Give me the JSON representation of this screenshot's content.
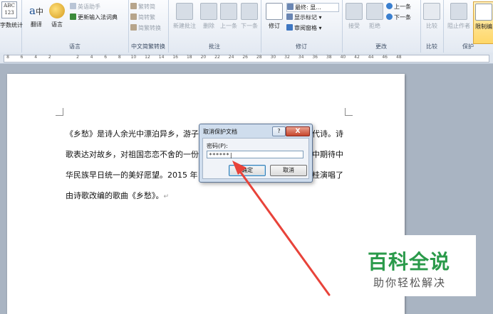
{
  "ribbon": {
    "proofing": {
      "abc_text": "ABC\n123",
      "word_count_label": "字数统计"
    },
    "language": {
      "translate_label": "翻译",
      "language_label": "语言",
      "english_assistant_label": "英语助手",
      "update_ime_label": "更新输入法词典",
      "group_label": "语言"
    },
    "chinese_conversion": {
      "trad_to_simp_label": "繁转简",
      "simp_to_trad_label": "简转繁",
      "conversion_label": "简繁转换",
      "group_label": "中文简繁转换"
    },
    "comments": {
      "new_comment_label": "新建批注",
      "delete_label": "删除",
      "prev_label": "上一条",
      "next_label": "下一条",
      "group_label": "批注"
    },
    "tracking": {
      "track_changes_label": "修订",
      "final_label": "最终: 显...",
      "show_markup_label": "显示标记",
      "review_pane_label": "审阅窗格",
      "group_label": "修订"
    },
    "changes": {
      "accept_label": "接受",
      "reject_label": "拒绝",
      "prev_label": "上一条",
      "next_label": "下一条",
      "group_label": "更改"
    },
    "compare": {
      "compare_label": "比较",
      "group_label": "比较"
    },
    "protect": {
      "block_authors_label": "阻止作者",
      "restrict_editing_label": "限制编",
      "group_label": "保护"
    }
  },
  "ruler": {
    "ticks": [
      "8",
      "6",
      "4",
      "2",
      "",
      "2",
      "4",
      "6",
      "8",
      "10",
      "12",
      "14",
      "16",
      "18",
      "20",
      "22",
      "24",
      "26",
      "28",
      "30",
      "32",
      "34",
      "36",
      "38",
      "40",
      "42",
      "44",
      "46",
      "48"
    ]
  },
  "document": {
    "lines": [
      "《乡愁》是诗人余光中漂泊异乡，游子",
      "歌表达对故乡，对祖国恋恋不舍的一份",
      "华民族早日统一的美好愿望。2015 年",
      "由诗歌改编的歌曲《乡愁》。"
    ],
    "right_fragments": [
      "代诗。诗",
      "中期待中",
      "桂演唱了"
    ],
    "paragraph_mark": "↵"
  },
  "dialog": {
    "title": "取消保护文档",
    "help_label": "?",
    "close_label": "X",
    "password_label": "密码(P):",
    "password_value": "******",
    "ok_label": "确定",
    "cancel_label": "取消"
  },
  "watermark": {
    "title": "百科全说",
    "subtitle": "助你轻松解决"
  },
  "colors": {
    "arrow": "#e8433a",
    "watermark_green": "#2a9a4a",
    "ribbon_bg": "#e3e9f2"
  }
}
